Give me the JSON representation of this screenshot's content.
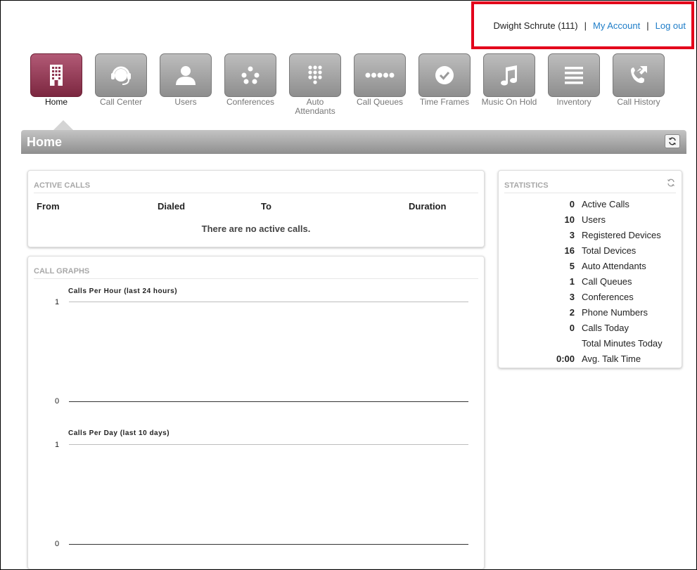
{
  "user": {
    "name": "Dwight Schrute (111)",
    "separator": "|",
    "my_account": "My Account",
    "logout": "Log out"
  },
  "nav": [
    {
      "label": "Home",
      "icon": "building-icon",
      "active": true
    },
    {
      "label": "Call Center",
      "icon": "headset-icon"
    },
    {
      "label": "Users",
      "icon": "user-icon"
    },
    {
      "label": "Conferences",
      "icon": "conference-icon"
    },
    {
      "label": "Auto Attendants",
      "icon": "keypad-icon"
    },
    {
      "label": "Call Queues",
      "icon": "queue-dots-icon"
    },
    {
      "label": "Time Frames",
      "icon": "clock-icon"
    },
    {
      "label": "Music On Hold",
      "icon": "music-note-icon"
    },
    {
      "label": "Inventory",
      "icon": "list-icon"
    },
    {
      "label": "Call History",
      "icon": "phone-arrows-icon"
    }
  ],
  "section": {
    "title": "Home"
  },
  "active_calls": {
    "title": "ACTIVE CALLS",
    "columns": [
      "From",
      "Dialed",
      "To",
      "Duration"
    ],
    "empty_message": "There are no active calls."
  },
  "call_graphs": {
    "title": "CALL GRAPHS",
    "graphs": [
      {
        "title": "Calls Per Hour (last 24 hours)",
        "y_max": "1",
        "y_min": "0"
      },
      {
        "title": "Calls Per Day (last 10 days)",
        "y_max": "1",
        "y_min": "0"
      }
    ]
  },
  "statistics": {
    "title": "STATISTICS",
    "rows": [
      {
        "value": "0",
        "label": "Active Calls"
      },
      {
        "value": "10",
        "label": "Users"
      },
      {
        "value": "3",
        "label": "Registered Devices"
      },
      {
        "value": "16",
        "label": "Total Devices"
      },
      {
        "value": "5",
        "label": "Auto Attendants"
      },
      {
        "value": "1",
        "label": "Call Queues"
      },
      {
        "value": "3",
        "label": "Conferences"
      },
      {
        "value": "2",
        "label": "Phone Numbers"
      },
      {
        "value": "0",
        "label": "Calls Today"
      },
      {
        "value": "",
        "label": "Total Minutes Today"
      },
      {
        "value": "0:00",
        "label": "Avg. Talk Time"
      }
    ]
  },
  "colors": {
    "active_tile": "#8e3550",
    "link": "#1e7dc8",
    "highlight": "#e3001b"
  }
}
